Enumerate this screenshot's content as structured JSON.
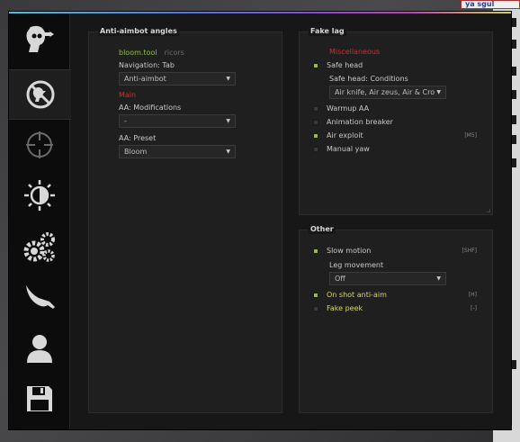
{
  "background": {
    "badge_text": "ya sgul"
  },
  "sidebar": {
    "tabs": [
      {
        "icon": "rage-head-icon"
      },
      {
        "icon": "anti-aim-icon",
        "active": true
      },
      {
        "icon": "crosshair-icon"
      },
      {
        "icon": "visuals-icon"
      },
      {
        "icon": "misc-gears-icon"
      },
      {
        "icon": "knife-icon"
      },
      {
        "icon": "player-icon"
      },
      {
        "icon": "save-config-icon"
      }
    ]
  },
  "left_group": {
    "title": "Anti-aimbot angles",
    "links": {
      "left": "bloom.tool",
      "right": "ricors"
    },
    "navigation_label": "Navigation: Tab",
    "navigation_value": "Anti-aimbot",
    "main_label": "Main",
    "modifications_label": "AA: Modifications",
    "modifications_value": "-",
    "preset_label": "AA: Preset",
    "preset_value": "Bloom"
  },
  "fake_lag": {
    "title": "Fake lag",
    "section_label": "Miscellaneous",
    "safe_head": {
      "label": "Safe head",
      "checked": true
    },
    "conditions_label": "Safe head: Conditions",
    "conditions_value": "Air knife, Air zeus, Air & Cro",
    "warmup": {
      "label": "Warmup AA",
      "checked": false
    },
    "animation_breaker": {
      "label": "Animation breaker",
      "checked": false
    },
    "air_exploit": {
      "label": "Air exploit",
      "checked": true,
      "key": "[M5]"
    },
    "manual_yaw": {
      "label": "Manual yaw",
      "checked": false
    }
  },
  "other": {
    "title": "Other",
    "slow_motion": {
      "label": "Slow motion",
      "checked": true,
      "key": "[SHF]"
    },
    "leg_movement_label": "Leg movement",
    "leg_movement_value": "Off",
    "on_shot": {
      "label": "On shot anti-aim",
      "checked": true,
      "key": "[H]"
    },
    "fake_peek": {
      "label": "Fake peek",
      "checked": false,
      "key": "[-]"
    }
  },
  "colors": {
    "accent_green": "#8fbf3c",
    "red_label": "#d82b2b",
    "yellow_label": "#d6d66a"
  }
}
